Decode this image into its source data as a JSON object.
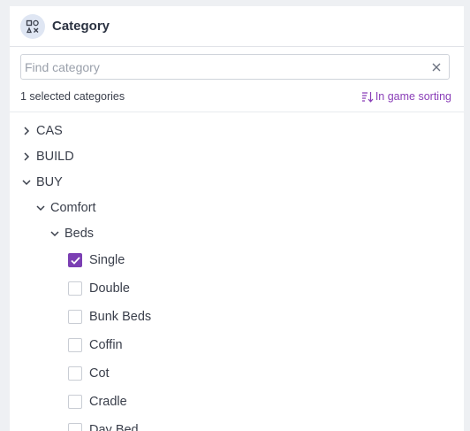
{
  "header": {
    "title": "Category",
    "icon": "shapes-icon"
  },
  "search": {
    "placeholder": "Find category",
    "value": ""
  },
  "selection": {
    "count_text": "1 selected categories",
    "sort_label": "In game sorting"
  },
  "colors": {
    "accent": "#7b3fb3",
    "sort_link": "#8a3fb8"
  },
  "tree": {
    "cas": {
      "label": "CAS",
      "expanded": false
    },
    "build": {
      "label": "BUILD",
      "expanded": false
    },
    "buy": {
      "label": "BUY",
      "expanded": true
    },
    "comfort": {
      "label": "Comfort",
      "expanded": true
    },
    "beds": {
      "label": "Beds",
      "expanded": true
    },
    "items": [
      {
        "label": "Single",
        "checked": true
      },
      {
        "label": "Double",
        "checked": false
      },
      {
        "label": "Bunk Beds",
        "checked": false
      },
      {
        "label": "Coffin",
        "checked": false
      },
      {
        "label": "Cot",
        "checked": false
      },
      {
        "label": "Cradle",
        "checked": false
      },
      {
        "label": "Day Bed",
        "checked": false
      }
    ]
  }
}
